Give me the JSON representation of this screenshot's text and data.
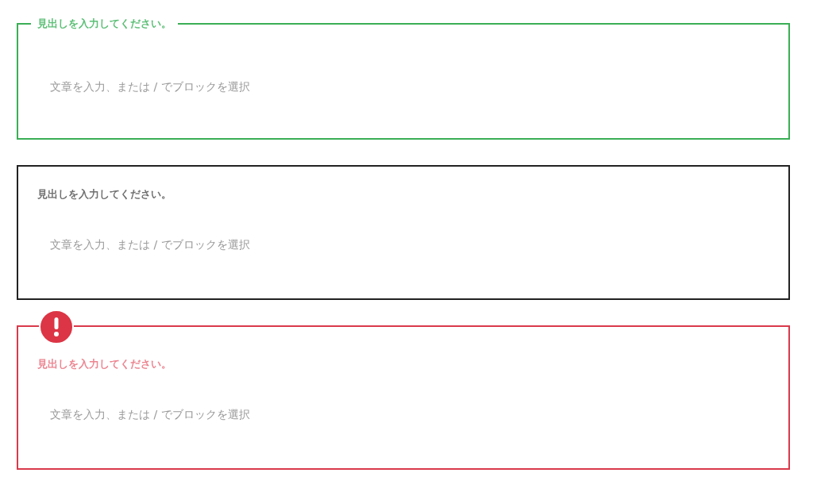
{
  "blocks": [
    {
      "kind": "legend",
      "heading": "見出しを入力してください。",
      "body": {
        "placeholder": "文章を入力、または / でブロックを選択"
      }
    },
    {
      "kind": "plain",
      "heading": "見出しを入力してください。",
      "body": {
        "placeholder": "文章を入力、または / でブロックを選択"
      }
    },
    {
      "kind": "alert",
      "heading": "見出しを入力してください。",
      "body": {
        "placeholder": "文章を入力、または / でブロックを選択"
      }
    }
  ]
}
